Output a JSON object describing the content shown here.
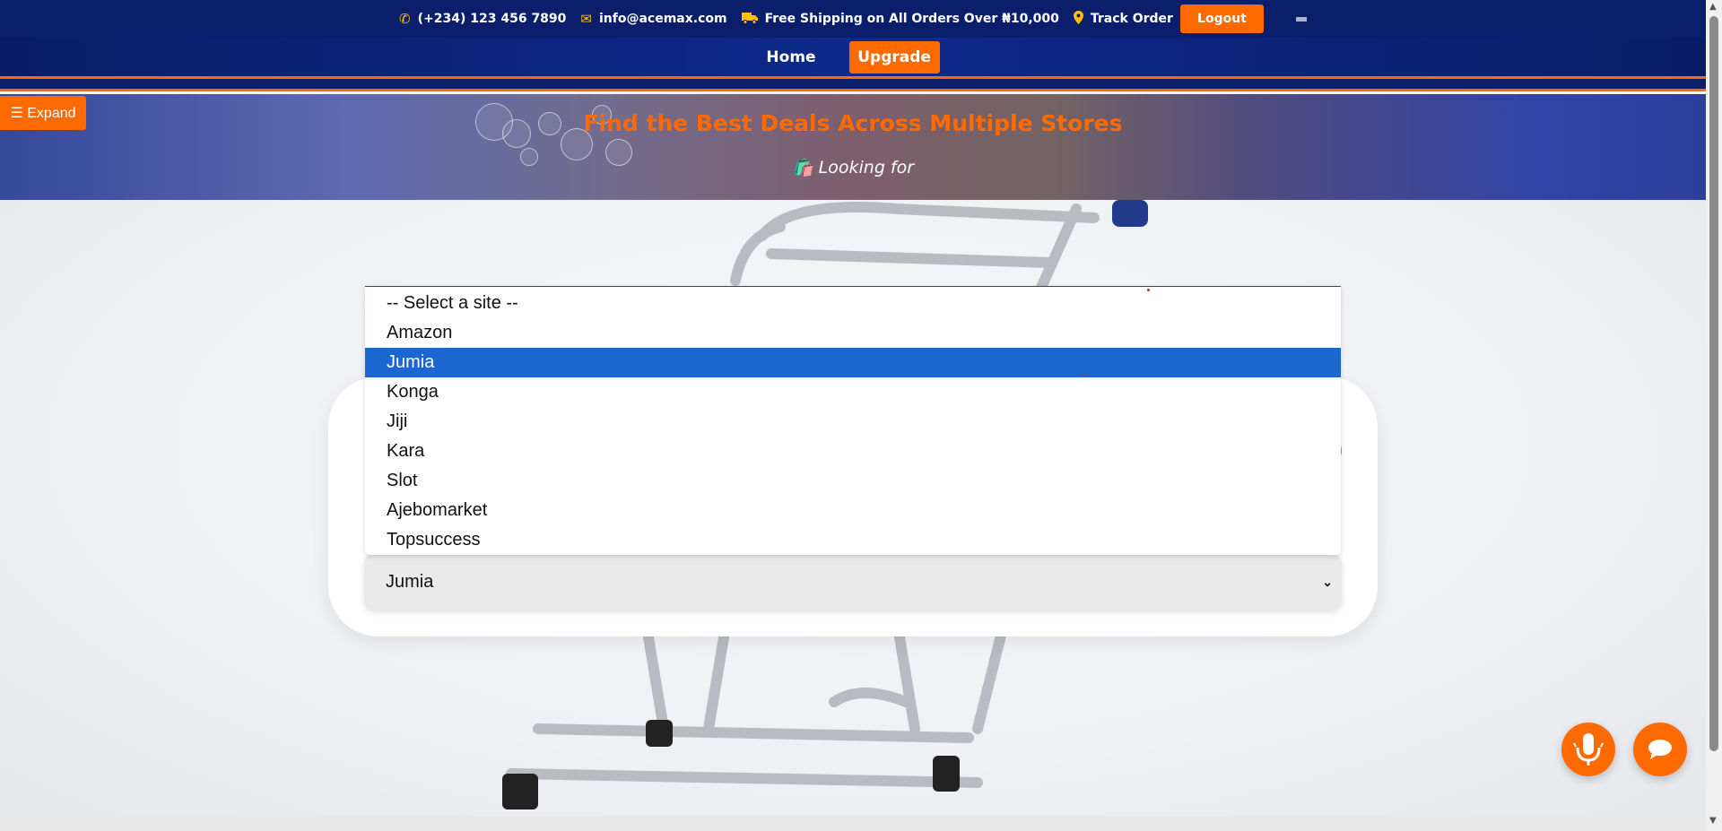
{
  "topbar": {
    "phone": "(+234) 123 456 7890",
    "email": "info@acemax.com",
    "shipping": "Free Shipping on All Orders Over ₦10,000",
    "track": "Track Order",
    "logout": "Logout"
  },
  "nav": {
    "home": "Home",
    "upgrade": "Upgrade"
  },
  "hero": {
    "title": "Find the Best Deals Across Multiple Stores",
    "subtitle": "Looking for"
  },
  "sidebar": {
    "expand": "☰ Expand"
  },
  "site_select": {
    "selected": "Jumia",
    "options": [
      "-- Select a site --",
      "Amazon",
      "Jumia",
      "Konga",
      "Jiji",
      "Kara",
      "Slot",
      "Ajebomarket",
      "Topsuccess"
    ]
  },
  "icons": {
    "phone": "phone-icon",
    "email": "envelope-icon",
    "truck": "truck-icon",
    "location": "map-marker-icon",
    "mic": "microphone-icon",
    "chat": "chat-bubble-icon"
  },
  "colors": {
    "accent": "#ff6a00",
    "navy": "#0b1e6b",
    "selected": "#1c66d1"
  }
}
